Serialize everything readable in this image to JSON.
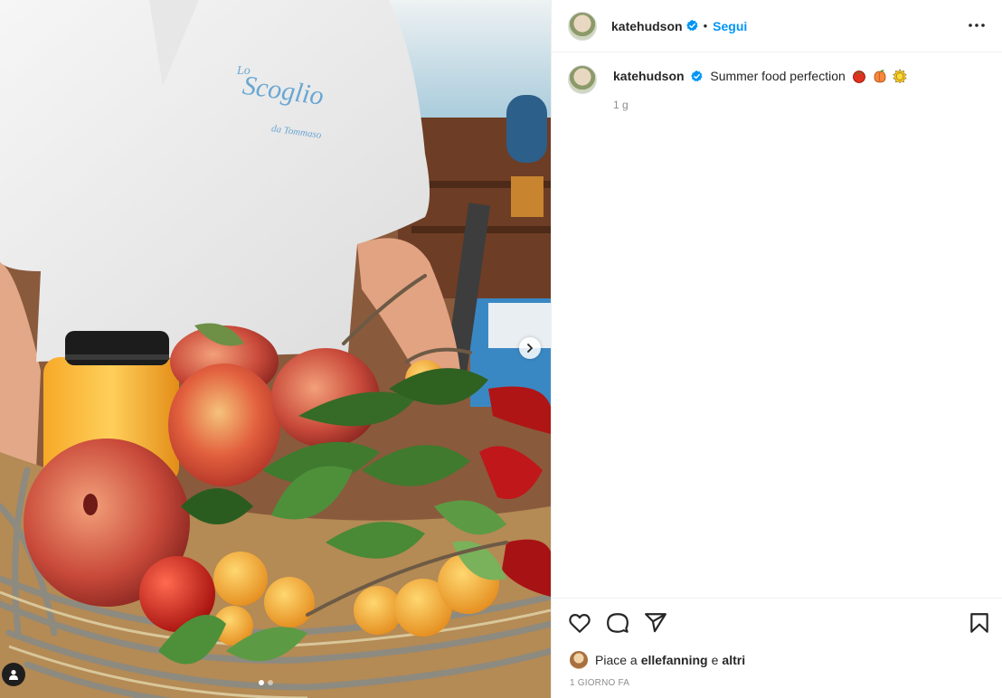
{
  "post": {
    "author": "katehudson",
    "follow_label": "Segui",
    "bullet": "•",
    "caption_text": "Summer food perfection",
    "caption_emojis": [
      "tomato-emoji",
      "peach-emoji",
      "sun-emoji"
    ],
    "caption_time": "1 g",
    "likes_prefix": "Piace a",
    "likes_user": "ellefanning",
    "likes_conjunction": "e",
    "likes_others": "altri",
    "date": "1 GIORNO FA"
  },
  "media": {
    "shirt_print_line1": "Lo",
    "shirt_print_line2": "Scoglio",
    "shirt_print_line3": "da Tommaso",
    "carousel_count": 2,
    "carousel_active": 1
  },
  "icons": {
    "verified": "verified-badge-icon",
    "more": "more-options-icon",
    "like": "heart-icon",
    "comment": "comment-icon",
    "share": "share-icon",
    "save": "bookmark-icon",
    "next": "chevron-right-icon",
    "user_tag": "user-tag-icon"
  },
  "colors": {
    "accent": "#0095f6",
    "text": "#262626",
    "muted": "#8e8e8e",
    "divider": "#efefef"
  }
}
